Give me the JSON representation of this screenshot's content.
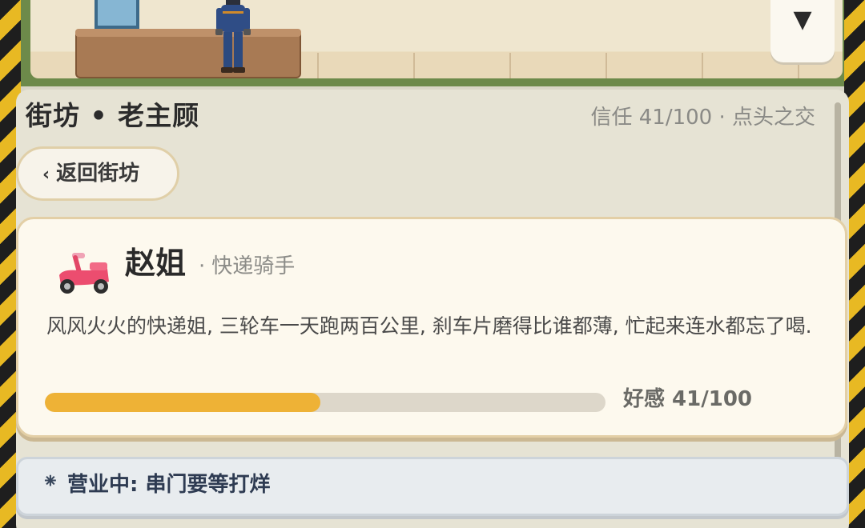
{
  "scene": {
    "dropdown_icon": "▼"
  },
  "header": {
    "title": "街坊 • 老主顾",
    "trust": "信任 41/100 · 点头之交"
  },
  "back_button": {
    "chevron": "‹",
    "label": "返回街坊"
  },
  "character": {
    "icon": "scooter-icon",
    "name": "赵姐",
    "role_separator": "·",
    "role": "快递骑手",
    "description": "风风火火的快递姐, 三轮车一天跑两百公里, 刹车片磨得比谁都薄, 忙起来连水都忘了喝.",
    "affection_fraction": 0.41,
    "affection_label": "好感 41/100"
  },
  "status": {
    "icon": "⁕",
    "text": "营业中: 串门要等打烊"
  },
  "colors": {
    "accent": "#eeb236",
    "scooter": "#ec4d6f"
  }
}
